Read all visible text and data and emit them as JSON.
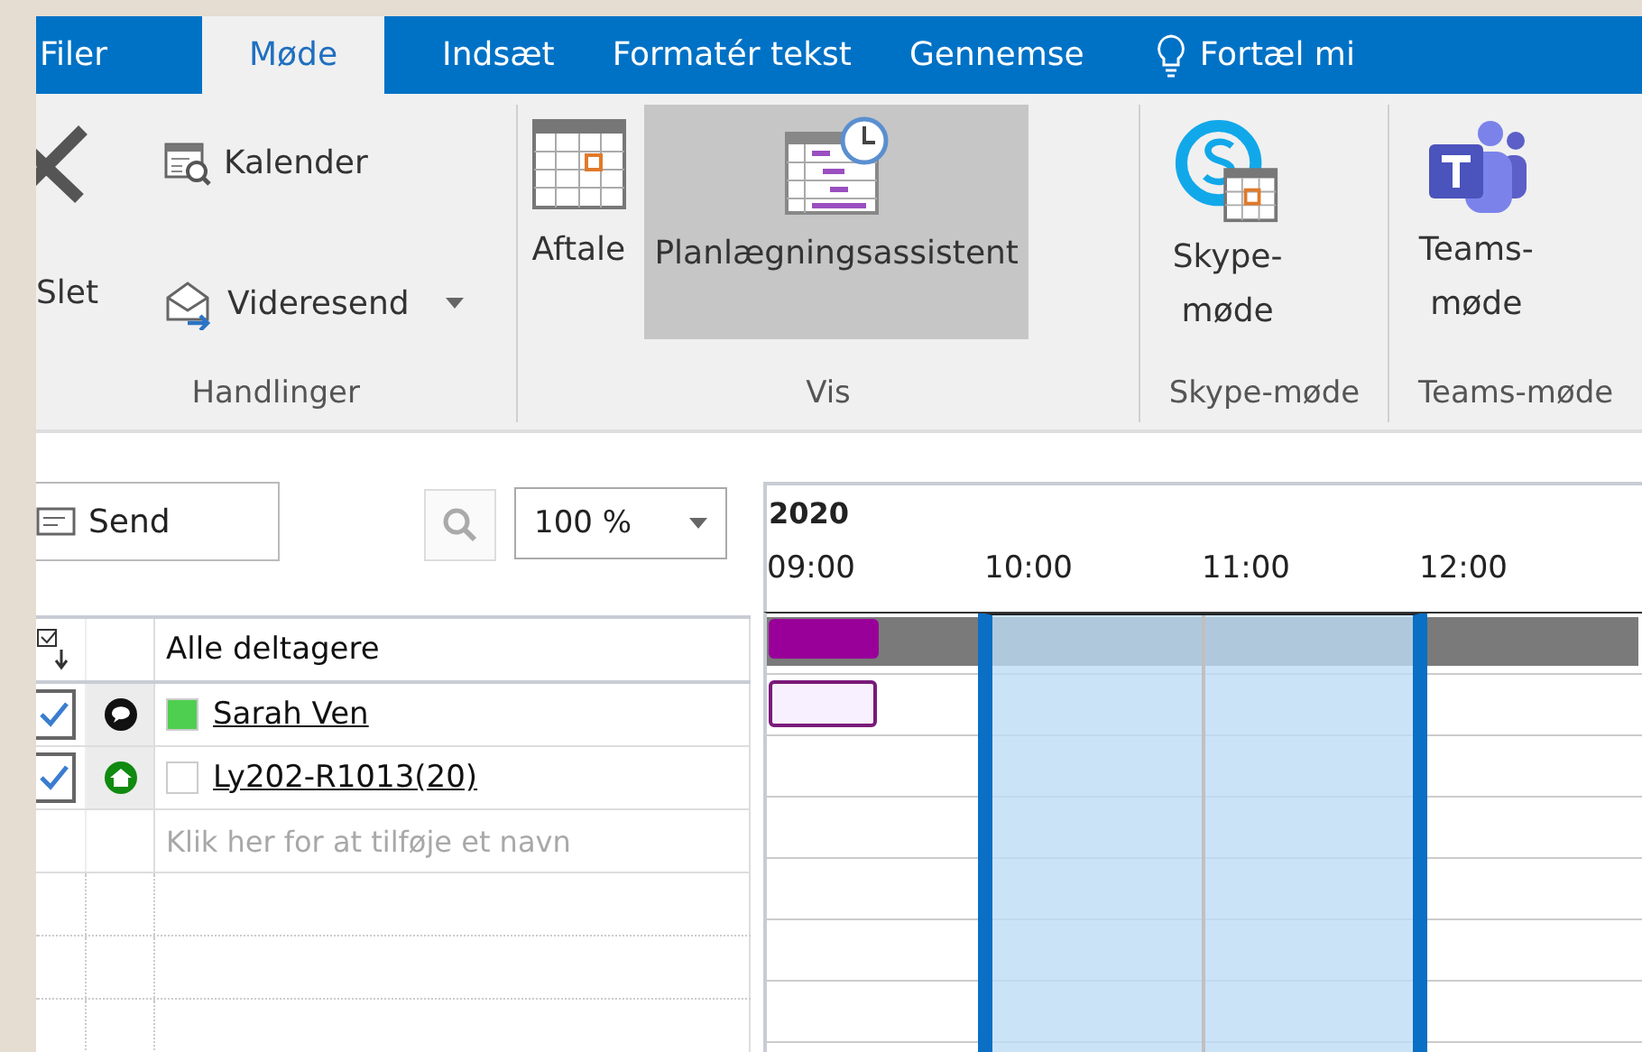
{
  "tabs": [
    {
      "label": "Filer",
      "selected": false
    },
    {
      "label": "Møde",
      "selected": true
    },
    {
      "label": "Indsæt",
      "selected": false
    },
    {
      "label": "Formatér tekst",
      "selected": false
    },
    {
      "label": "Gennemse",
      "selected": false
    }
  ],
  "tell_me": "Fortæl mi",
  "ribbon": {
    "groups": [
      {
        "label": "Handlinger",
        "buttons": [
          {
            "kind": "delete",
            "label": "Slet",
            "selected": false
          },
          {
            "kind": "calendar",
            "label": "Kalender",
            "selected": false
          },
          {
            "kind": "forward",
            "label": "Videresend",
            "selected": false,
            "dropdown": true
          }
        ]
      },
      {
        "label": "Vis",
        "buttons": [
          {
            "kind": "appointment",
            "label": "Aftale",
            "selected": false
          },
          {
            "kind": "scheduling",
            "label": "Planlægningsassistent",
            "selected": true
          }
        ]
      },
      {
        "label": "Skype-møde",
        "buttons": [
          {
            "kind": "skype",
            "label": "Skype-møde",
            "selected": false
          }
        ]
      },
      {
        "label": "Teams-møde",
        "buttons": [
          {
            "kind": "teams",
            "label": "Teams-møde",
            "selected": false
          }
        ]
      }
    ]
  },
  "toolbar": {
    "send": "Send",
    "zoom": "100 %"
  },
  "schedule": {
    "year": "2020",
    "hours": [
      "09:00",
      "10:00",
      "11:00",
      "12:00"
    ],
    "all_label": "Alle deltagere",
    "all_busy": true,
    "attendees": [
      {
        "name": "Sarah Ven",
        "checked": true,
        "kind": "organizer",
        "color": "#4fcf4f",
        "busy": true
      },
      {
        "name": "Ly202-R1013(20)",
        "checked": true,
        "kind": "room",
        "color": "#ffffff",
        "busy": false
      }
    ],
    "placeholder": "Klik her for at tilføje et navn"
  }
}
